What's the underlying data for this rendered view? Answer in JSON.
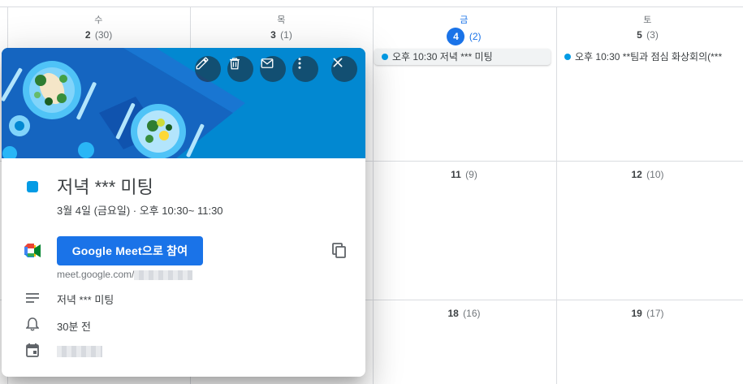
{
  "calendar": {
    "days": [
      {
        "dow": "수",
        "num": "2",
        "count": "(30)"
      },
      {
        "dow": "목",
        "num": "3",
        "count": "(1)"
      },
      {
        "dow": "금",
        "num": "4",
        "count": "(2)",
        "today": true
      },
      {
        "dow": "토",
        "num": "5",
        "count": "(3)"
      }
    ],
    "events": [
      {
        "label": "오후 10:30 저녁 *** 미팅"
      },
      {
        "label": "오후 10:30 **팀과 점심 화상회의(***"
      }
    ],
    "week2": [
      {
        "num": "11",
        "count": "(9)"
      },
      {
        "num": "12",
        "count": "(10)"
      }
    ],
    "week3": [
      {
        "num": "18",
        "count": "(16)"
      },
      {
        "num": "19",
        "count": "(17)"
      }
    ],
    "event_color": "#039be5",
    "today_color": "#1a73e8"
  },
  "popup": {
    "title": "저녁 *** 미팅",
    "datetime": "3월 4일 (금요일)  ·  오후 10:30~ 11:30",
    "meet_button": "Google Meet으로 참여",
    "meet_link": "meet.google.com/",
    "description": "저녁 *** 미팅",
    "reminder": "30분 전",
    "toolbar_icons": [
      "pencil-icon",
      "trash-icon",
      "mail-icon",
      "more-vert-icon",
      "close-icon"
    ],
    "banner_color": "#0288d1",
    "button_color": "#1a73e8"
  }
}
